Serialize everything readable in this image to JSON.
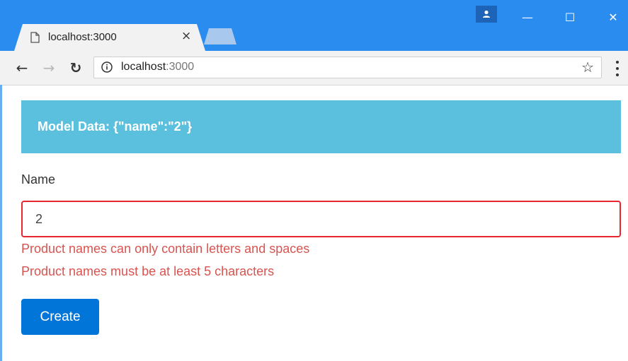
{
  "browser": {
    "tab_title": "localhost:3000",
    "tab_close": "×",
    "url_host": "localhost",
    "url_rest": ":3000",
    "window_controls": {
      "minimize": "—",
      "maximize": "☐",
      "close": "✕"
    },
    "nav": {
      "back": "←",
      "forward": "→",
      "reload": "↻"
    },
    "bookmark_icon": "☆",
    "accent_color": "#2b8cf0"
  },
  "page": {
    "model_data_label": "Model Data: {\"name\":\"2\"}",
    "field_label": "Name",
    "input_value": "2",
    "errors": [
      "Product names can only contain letters and spaces",
      "Product names must be at least 5 characters"
    ],
    "create_label": "Create",
    "colors": {
      "info": "#5bc0de",
      "danger": "#d9534f",
      "primary": "#0275d8"
    }
  }
}
